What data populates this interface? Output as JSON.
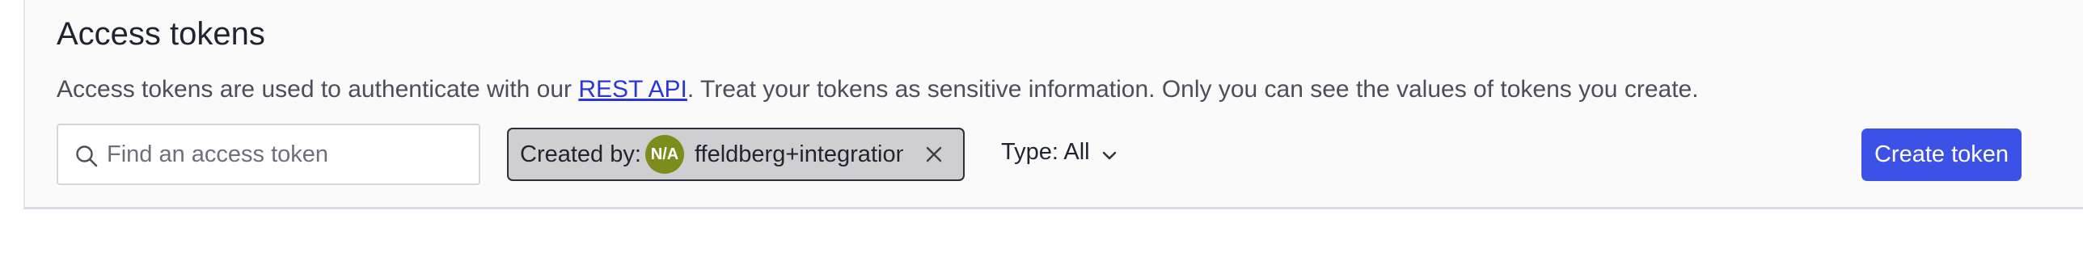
{
  "section": {
    "title": "Access tokens",
    "description_before_link": "Access tokens are used to authenticate with our ",
    "description_link": "REST API",
    "description_after_link": ". Treat your tokens as sensitive information. Only you can see the values of tokens you create."
  },
  "search": {
    "placeholder": "Find an access token",
    "value": ""
  },
  "filter_chip": {
    "label": "Created by:",
    "avatar_initials": "N/A",
    "user": "ffeldberg+integration",
    "avatar_color": "#7d8d1d"
  },
  "type_filter": {
    "label": "Type: All"
  },
  "actions": {
    "create_label": "Create token",
    "accent_color": "#3c52e6"
  },
  "icons": {
    "search": "search-icon",
    "close": "close-icon",
    "chevron": "chevron-down-icon"
  }
}
